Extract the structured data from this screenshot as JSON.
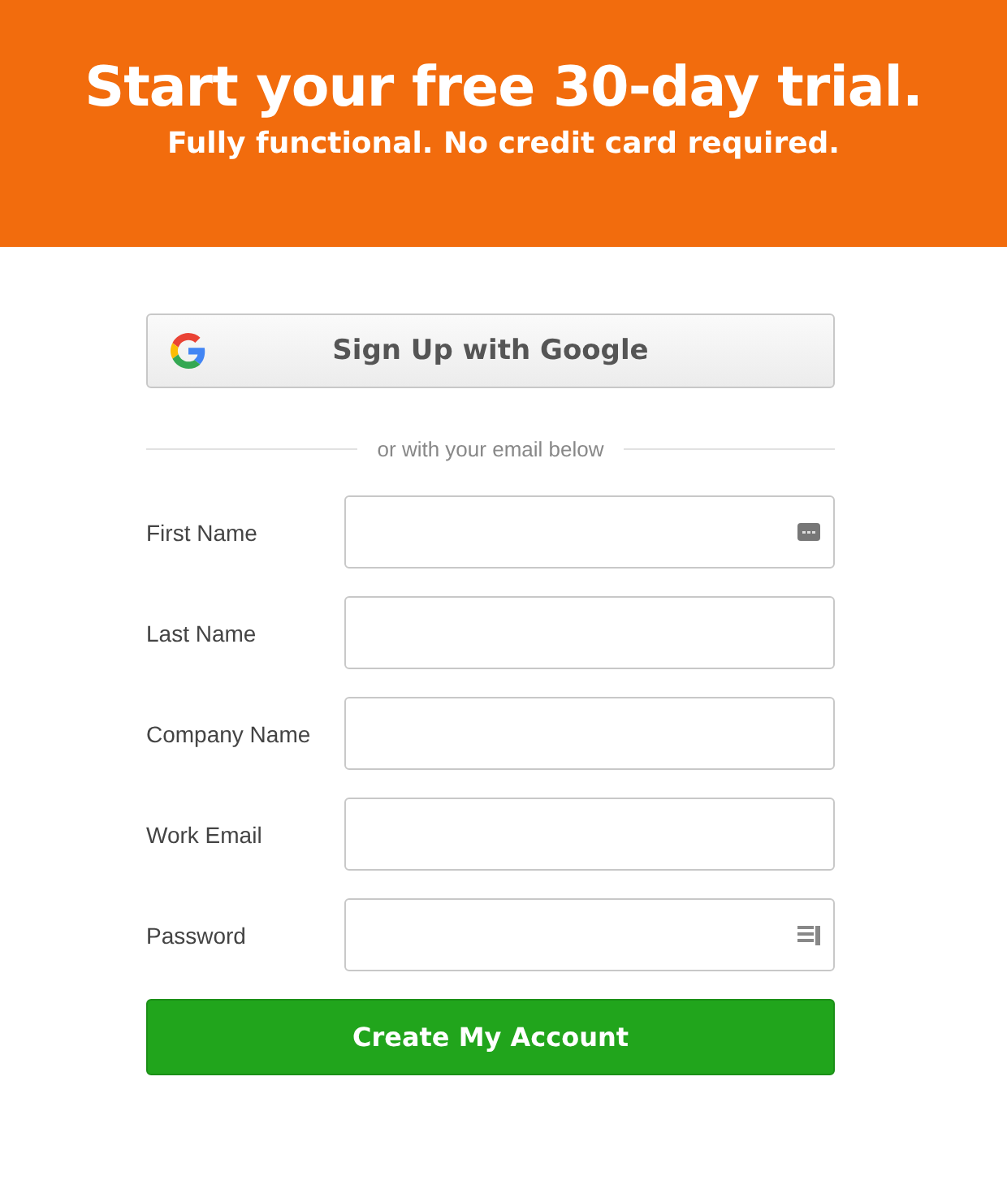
{
  "header": {
    "title": "Start your free 30-day trial.",
    "subtitle": "Fully functional. No credit card required."
  },
  "google_button": {
    "label": "Sign Up with Google"
  },
  "divider": {
    "label": "or with your email below"
  },
  "fields": [
    {
      "label": "First Name",
      "kind": "contact"
    },
    {
      "label": "Last Name",
      "kind": "text"
    },
    {
      "label": "Company Name",
      "kind": "text"
    },
    {
      "label": "Work Email",
      "kind": "text"
    },
    {
      "label": "Password",
      "kind": "password"
    }
  ],
  "submit_button": {
    "label": "Create My Account"
  }
}
